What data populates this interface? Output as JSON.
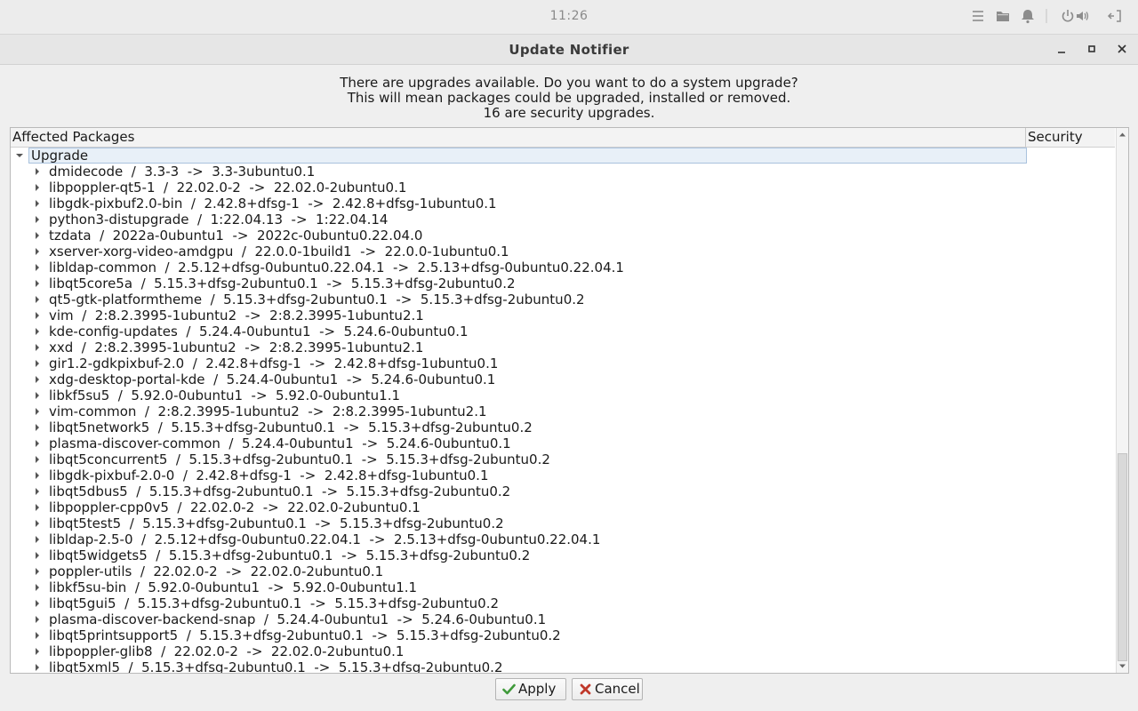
{
  "panel": {
    "clock": "11:26",
    "tray_icons": [
      "menu-icon",
      "folder-icon",
      "bell-icon",
      "power-icon",
      "volume-icon",
      "logout-icon"
    ]
  },
  "window": {
    "title": "Update Notifier",
    "message_lines": [
      "There are upgrades available. Do you want to do a system upgrade?",
      "This will mean packages could be upgraded, installed or removed.",
      "16 are security upgrades."
    ]
  },
  "tree": {
    "columns": [
      "Affected Packages",
      "Security"
    ],
    "group": "Upgrade",
    "packages": [
      "dmidecode  /  3.3-3  ->  3.3-3ubuntu0.1",
      "libpoppler-qt5-1  /  22.02.0-2  ->  22.02.0-2ubuntu0.1",
      "libgdk-pixbuf2.0-bin  /  2.42.8+dfsg-1  ->  2.42.8+dfsg-1ubuntu0.1",
      "python3-distupgrade  /  1:22.04.13  ->  1:22.04.14",
      "tzdata  /  2022a-0ubuntu1  ->  2022c-0ubuntu0.22.04.0",
      "xserver-xorg-video-amdgpu  /  22.0.0-1build1  ->  22.0.0-1ubuntu0.1",
      "libldap-common  /  2.5.12+dfsg-0ubuntu0.22.04.1  ->  2.5.13+dfsg-0ubuntu0.22.04.1",
      "libqt5core5a  /  5.15.3+dfsg-2ubuntu0.1  ->  5.15.3+dfsg-2ubuntu0.2",
      "qt5-gtk-platformtheme  /  5.15.3+dfsg-2ubuntu0.1  ->  5.15.3+dfsg-2ubuntu0.2",
      "vim  /  2:8.2.3995-1ubuntu2  ->  2:8.2.3995-1ubuntu2.1",
      "kde-config-updates  /  5.24.4-0ubuntu1  ->  5.24.6-0ubuntu0.1",
      "xxd  /  2:8.2.3995-1ubuntu2  ->  2:8.2.3995-1ubuntu2.1",
      "gir1.2-gdkpixbuf-2.0  /  2.42.8+dfsg-1  ->  2.42.8+dfsg-1ubuntu0.1",
      "xdg-desktop-portal-kde  /  5.24.4-0ubuntu1  ->  5.24.6-0ubuntu0.1",
      "libkf5su5  /  5.92.0-0ubuntu1  ->  5.92.0-0ubuntu1.1",
      "vim-common  /  2:8.2.3995-1ubuntu2  ->  2:8.2.3995-1ubuntu2.1",
      "libqt5network5  /  5.15.3+dfsg-2ubuntu0.1  ->  5.15.3+dfsg-2ubuntu0.2",
      "plasma-discover-common  /  5.24.4-0ubuntu1  ->  5.24.6-0ubuntu0.1",
      "libqt5concurrent5  /  5.15.3+dfsg-2ubuntu0.1  ->  5.15.3+dfsg-2ubuntu0.2",
      "libgdk-pixbuf-2.0-0  /  2.42.8+dfsg-1  ->  2.42.8+dfsg-1ubuntu0.1",
      "libqt5dbus5  /  5.15.3+dfsg-2ubuntu0.1  ->  5.15.3+dfsg-2ubuntu0.2",
      "libpoppler-cpp0v5  /  22.02.0-2  ->  22.02.0-2ubuntu0.1",
      "libqt5test5  /  5.15.3+dfsg-2ubuntu0.1  ->  5.15.3+dfsg-2ubuntu0.2",
      "libldap-2.5-0  /  2.5.12+dfsg-0ubuntu0.22.04.1  ->  2.5.13+dfsg-0ubuntu0.22.04.1",
      "libqt5widgets5  /  5.15.3+dfsg-2ubuntu0.1  ->  5.15.3+dfsg-2ubuntu0.2",
      "poppler-utils  /  22.02.0-2  ->  22.02.0-2ubuntu0.1",
      "libkf5su-bin  /  5.92.0-0ubuntu1  ->  5.92.0-0ubuntu1.1",
      "libqt5gui5  /  5.15.3+dfsg-2ubuntu0.1  ->  5.15.3+dfsg-2ubuntu0.2",
      "plasma-discover-backend-snap  /  5.24.4-0ubuntu1  ->  5.24.6-0ubuntu0.1",
      "libqt5printsupport5  /  5.15.3+dfsg-2ubuntu0.1  ->  5.15.3+dfsg-2ubuntu0.2",
      "libpoppler-glib8  /  22.02.0-2  ->  22.02.0-2ubuntu0.1",
      "libqt5xml5  /  5.15.3+dfsg-2ubuntu0.1  ->  5.15.3+dfsg-2ubuntu0.2"
    ]
  },
  "buttons": {
    "apply": "Apply",
    "cancel": "Cancel"
  },
  "colors": {
    "apply_icon": "#3f9a3a",
    "cancel_icon": "#c0392b",
    "selection": "#e8f0f8"
  }
}
